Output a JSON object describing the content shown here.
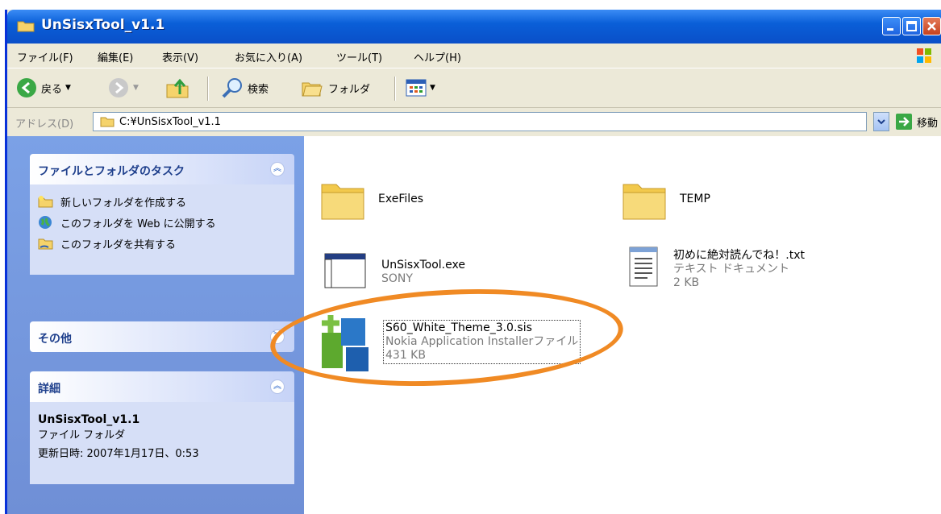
{
  "window": {
    "title": "UnSisxTool_v1.1"
  },
  "menu": [
    "ファイル(F)",
    "編集(E)",
    "表示(V)",
    "お気に入り(A)",
    "ツール(T)",
    "ヘルプ(H)"
  ],
  "toolbar": {
    "back_label": "戻る",
    "search_label": "検索",
    "folders_label": "フォルダ"
  },
  "address": {
    "label": "アドレス(D)",
    "value": "C:¥UnSisxTool_v1.1",
    "go_label": "移動"
  },
  "tasks_panel": {
    "title": "ファイルとフォルダのタスク",
    "items": [
      "新しいフォルダを作成する",
      "このフォルダを Web に公開する",
      "このフォルダを共有する"
    ]
  },
  "other_panel": {
    "title": "その他"
  },
  "details_panel": {
    "title": "詳細",
    "name": "UnSisxTool_v1.1",
    "type": "ファイル フォルダ",
    "modified": "更新日時: 2007年1月17日、0:53"
  },
  "files": [
    {
      "name": "ExeFiles"
    },
    {
      "name": "TEMP"
    },
    {
      "name": "UnSisxTool.exe",
      "sub1": "SONY"
    },
    {
      "name": "初めに絶対読んでね！.txt",
      "sub1": "テキスト ドキュメント",
      "sub2": "2 KB"
    },
    {
      "name": "S60_White_Theme_3.0.sis",
      "sub1": "Nokia Application Installerファイル",
      "sub2": "431 KB"
    }
  ],
  "colors": {
    "highlight": "#f08a24",
    "title_blue": "#0a5fd8",
    "sidebar": "#7ba1e6"
  }
}
